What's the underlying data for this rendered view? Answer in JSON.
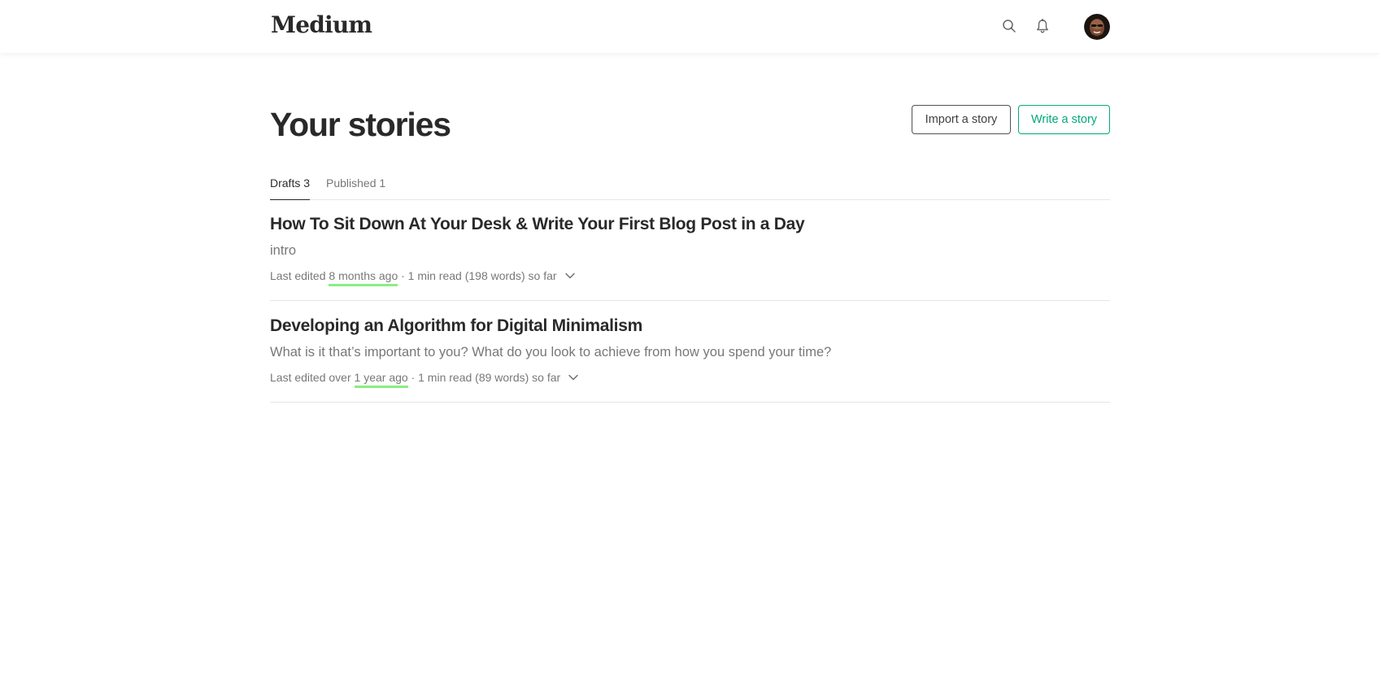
{
  "header": {
    "logo_text": "Medium",
    "icons": [
      "search-icon",
      "bell-icon"
    ],
    "avatar": "user-avatar"
  },
  "main": {
    "title": "Your stories",
    "import_label": "Import a story",
    "write_label": "Write a story",
    "tabs": [
      {
        "label": "Drafts 3",
        "active": true
      },
      {
        "label": "Published 1",
        "active": false
      }
    ],
    "stories": [
      {
        "title": "How To Sit Down At Your Desk & Write Your First Blog Post in a Day",
        "subtitle": "intro",
        "meta_prefix": "Last edited ",
        "meta_when": "8 months ago",
        "meta_suffix": " · 1 min read (198 words) so far"
      },
      {
        "title": "Developing an Algorithm for Digital Minimalism",
        "subtitle": "What is it that’s important to you? What do you look to achieve from how you spend your time?",
        "meta_prefix": "Last edited over ",
        "meta_when": "1 year ago",
        "meta_suffix": " · 1 min read (89 words) so far"
      }
    ]
  },
  "colors": {
    "accent_green": "#03a87c",
    "highlight_underline": "#89ee82"
  }
}
